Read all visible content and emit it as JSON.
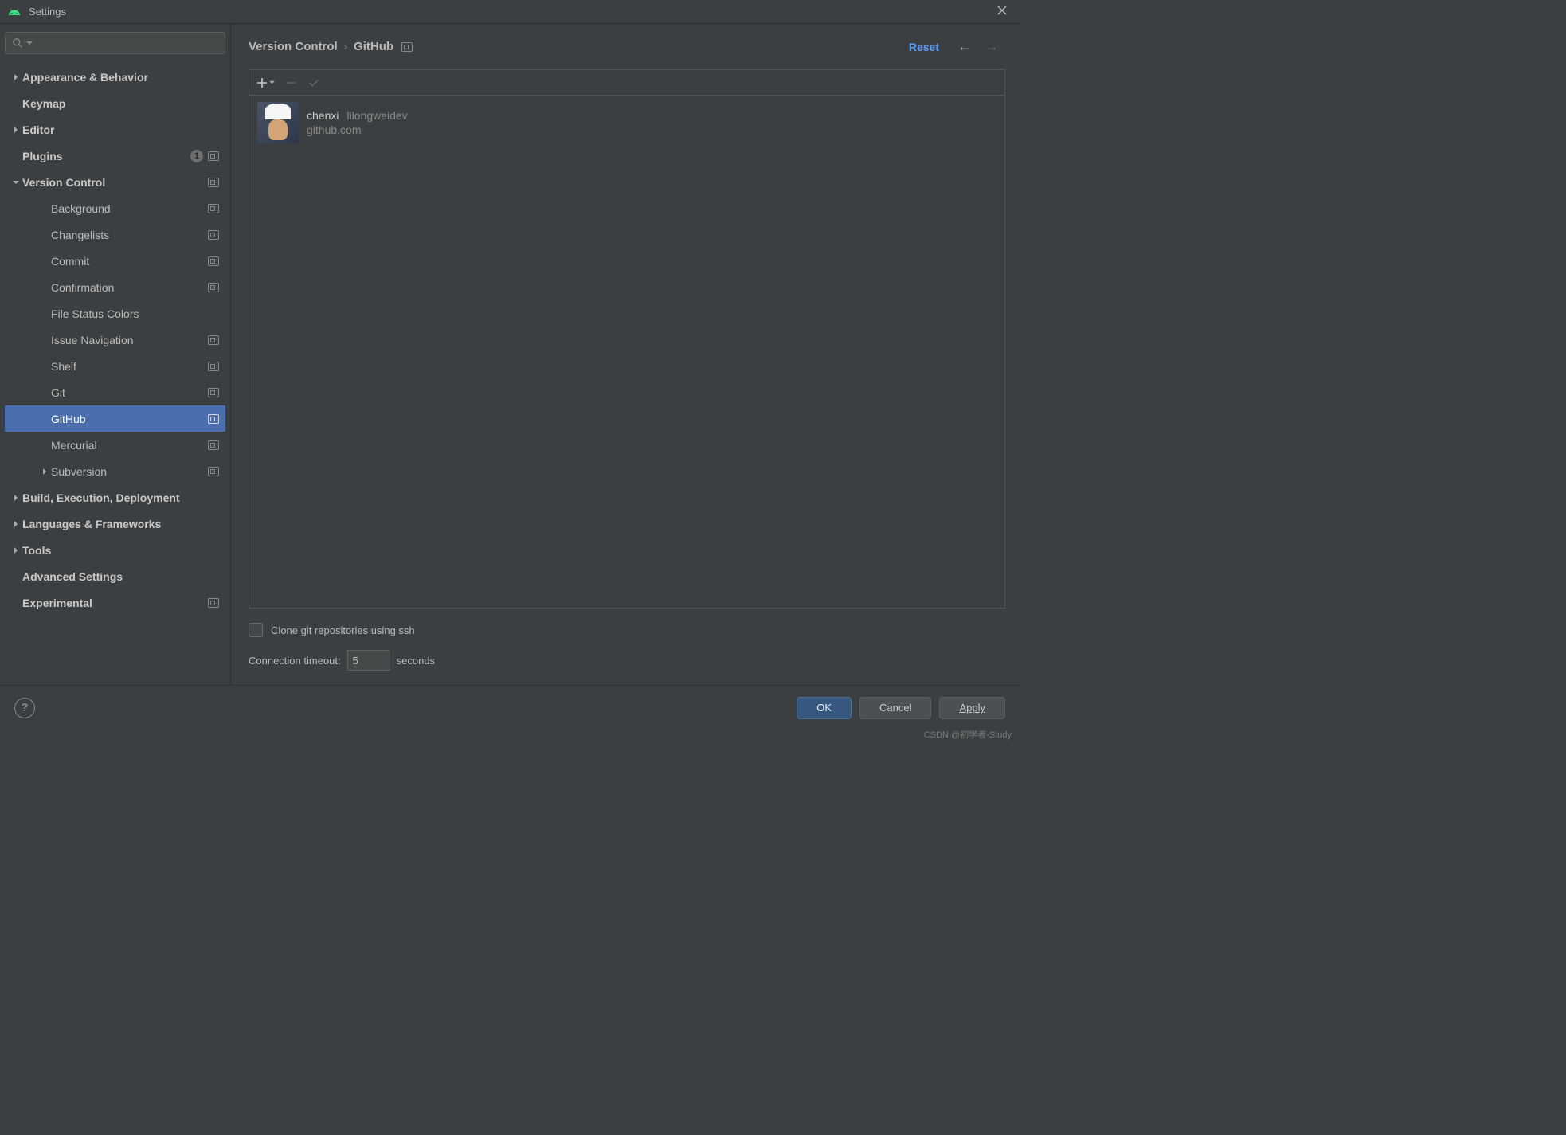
{
  "window": {
    "title": "Settings"
  },
  "sidebar": {
    "items": [
      {
        "label": "Appearance & Behavior",
        "bold": true,
        "arrow": ">",
        "proj": false
      },
      {
        "label": "Keymap",
        "bold": true,
        "arrow": "",
        "proj": false
      },
      {
        "label": "Editor",
        "bold": true,
        "arrow": ">",
        "proj": false
      },
      {
        "label": "Plugins",
        "bold": true,
        "arrow": "",
        "badge": "1",
        "proj": true
      },
      {
        "label": "Version Control",
        "bold": true,
        "arrow": "v",
        "proj": true
      },
      {
        "label": "Background",
        "indent": 2,
        "proj": true
      },
      {
        "label": "Changelists",
        "indent": 2,
        "proj": true
      },
      {
        "label": "Commit",
        "indent": 2,
        "proj": true
      },
      {
        "label": "Confirmation",
        "indent": 2,
        "proj": true
      },
      {
        "label": "File Status Colors",
        "indent": 2
      },
      {
        "label": "Issue Navigation",
        "indent": 2,
        "proj": true
      },
      {
        "label": "Shelf",
        "indent": 2,
        "proj": true
      },
      {
        "label": "Git",
        "indent": 2,
        "proj": true
      },
      {
        "label": "GitHub",
        "indent": 2,
        "proj": true,
        "selected": true
      },
      {
        "label": "Mercurial",
        "indent": 2,
        "proj": true
      },
      {
        "label": "Subversion",
        "indent": 2,
        "arrow": ">",
        "proj": true
      },
      {
        "label": "Build, Execution, Deployment",
        "bold": true,
        "arrow": ">"
      },
      {
        "label": "Languages & Frameworks",
        "bold": true,
        "arrow": ">"
      },
      {
        "label": "Tools",
        "bold": true,
        "arrow": ">"
      },
      {
        "label": "Advanced Settings",
        "bold": true
      },
      {
        "label": "Experimental",
        "bold": true,
        "proj": true
      }
    ]
  },
  "breadcrumb": {
    "root": "Version Control",
    "leaf": "GitHub",
    "reset": "Reset"
  },
  "account": {
    "name": "chenxi",
    "handle": "lilongweidev",
    "server": "github.com"
  },
  "options": {
    "ssh_label": "Clone git repositories using ssh",
    "timeout_label": "Connection timeout:",
    "timeout_value": "5",
    "timeout_unit": "seconds"
  },
  "buttons": {
    "ok": "OK",
    "cancel": "Cancel",
    "apply": "Apply"
  },
  "watermark": "CSDN @初学者-Study"
}
